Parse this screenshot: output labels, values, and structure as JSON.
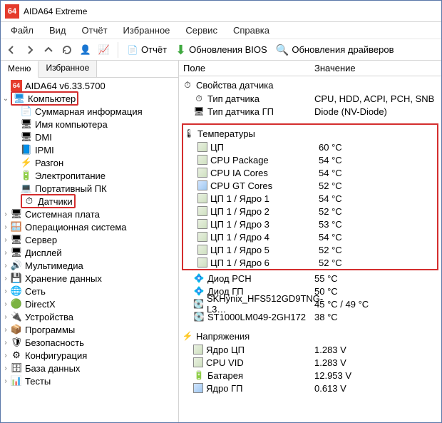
{
  "titlebar": {
    "title": "AIDA64 Extreme"
  },
  "menubar": [
    "Файл",
    "Вид",
    "Отчёт",
    "Избранное",
    "Сервис",
    "Справка"
  ],
  "toolbar": {
    "report": "Отчёт",
    "bios": "Обновления BIOS",
    "drivers": "Обновления драйверов"
  },
  "tabs": {
    "menu": "Меню",
    "fav": "Избранное"
  },
  "tree": {
    "root": "AIDA64 v6.33.5700",
    "computer": "Компьютер",
    "computer_children": [
      {
        "label": "Суммарная информация",
        "icon": "📄"
      },
      {
        "label": "Имя компьютера",
        "icon": "🖥"
      },
      {
        "label": "DMI",
        "icon": "🖥"
      },
      {
        "label": "IPMI",
        "icon": "📘"
      },
      {
        "label": "Разгон",
        "icon": "⚡"
      },
      {
        "label": "Электропитание",
        "icon": "🔋"
      },
      {
        "label": "Портативный ПК",
        "icon": "💻"
      }
    ],
    "sensors": "Датчики",
    "siblings": [
      {
        "label": "Системная плата",
        "icon": "🖥"
      },
      {
        "label": "Операционная система",
        "icon": "🪟"
      },
      {
        "label": "Сервер",
        "icon": "🖥"
      },
      {
        "label": "Дисплей",
        "icon": "🖥"
      },
      {
        "label": "Мультимедиа",
        "icon": "🔊"
      },
      {
        "label": "Хранение данных",
        "icon": "💾"
      },
      {
        "label": "Сеть",
        "icon": "🌐"
      },
      {
        "label": "DirectX",
        "icon": "🟢"
      },
      {
        "label": "Устройства",
        "icon": "🔌"
      },
      {
        "label": "Программы",
        "icon": "📦"
      },
      {
        "label": "Безопасность",
        "icon": "🛡"
      },
      {
        "label": "Конфигурация",
        "icon": "⚙"
      },
      {
        "label": "База данных",
        "icon": "🗄"
      },
      {
        "label": "Тесты",
        "icon": "📊"
      }
    ]
  },
  "pane": {
    "col1": "Поле",
    "col2": "Значение",
    "sensor_props": {
      "title": "Свойства датчика",
      "rows": [
        {
          "label": "Тип датчика",
          "value": "CPU, HDD, ACPI, PCH, SNB",
          "icon": "⏱"
        },
        {
          "label": "Тип датчика ГП",
          "value": "Diode  (NV-Diode)",
          "icon": "🖥"
        }
      ]
    },
    "temps": {
      "title": "Температуры",
      "rows": [
        {
          "label": "ЦП",
          "value": "60 °C",
          "cls": "chip"
        },
        {
          "label": "CPU Package",
          "value": "54 °C",
          "cls": "chip"
        },
        {
          "label": "CPU IA Cores",
          "value": "54 °C",
          "cls": "chip"
        },
        {
          "label": "CPU GT Cores",
          "value": "52 °C",
          "cls": "chip blue"
        },
        {
          "label": "ЦП 1 / Ядро 1",
          "value": "54 °C",
          "cls": "chip"
        },
        {
          "label": "ЦП 1 / Ядро 2",
          "value": "52 °C",
          "cls": "chip"
        },
        {
          "label": "ЦП 1 / Ядро 3",
          "value": "53 °C",
          "cls": "chip"
        },
        {
          "label": "ЦП 1 / Ядро 4",
          "value": "54 °C",
          "cls": "chip"
        },
        {
          "label": "ЦП 1 / Ядро 5",
          "value": "52 °C",
          "cls": "chip"
        },
        {
          "label": "ЦП 1 / Ядро 6",
          "value": "52 °C",
          "cls": "chip"
        }
      ]
    },
    "other_temps": [
      {
        "label": "Диод PCH",
        "value": "55 °C",
        "icon": "💠"
      },
      {
        "label": "Диод ГП",
        "value": "50 °C",
        "icon": "💠"
      },
      {
        "label": "SKHynix_HFS512GD9TNG-L3…",
        "value": "45 °C / 49 °C",
        "icon": "💽"
      },
      {
        "label": "ST1000LM049-2GH172",
        "value": "38 °C",
        "icon": "💽"
      }
    ],
    "voltages": {
      "title": "Напряжения",
      "rows": [
        {
          "label": "Ядро ЦП",
          "value": "1.283 V",
          "cls": "chip"
        },
        {
          "label": "CPU VID",
          "value": "1.283 V",
          "cls": "chip"
        },
        {
          "label": "Батарея",
          "value": "12.953 V",
          "icon": "🔋"
        },
        {
          "label": "Ядро ГП",
          "value": "0.613 V",
          "cls": "chip blue"
        }
      ]
    }
  }
}
